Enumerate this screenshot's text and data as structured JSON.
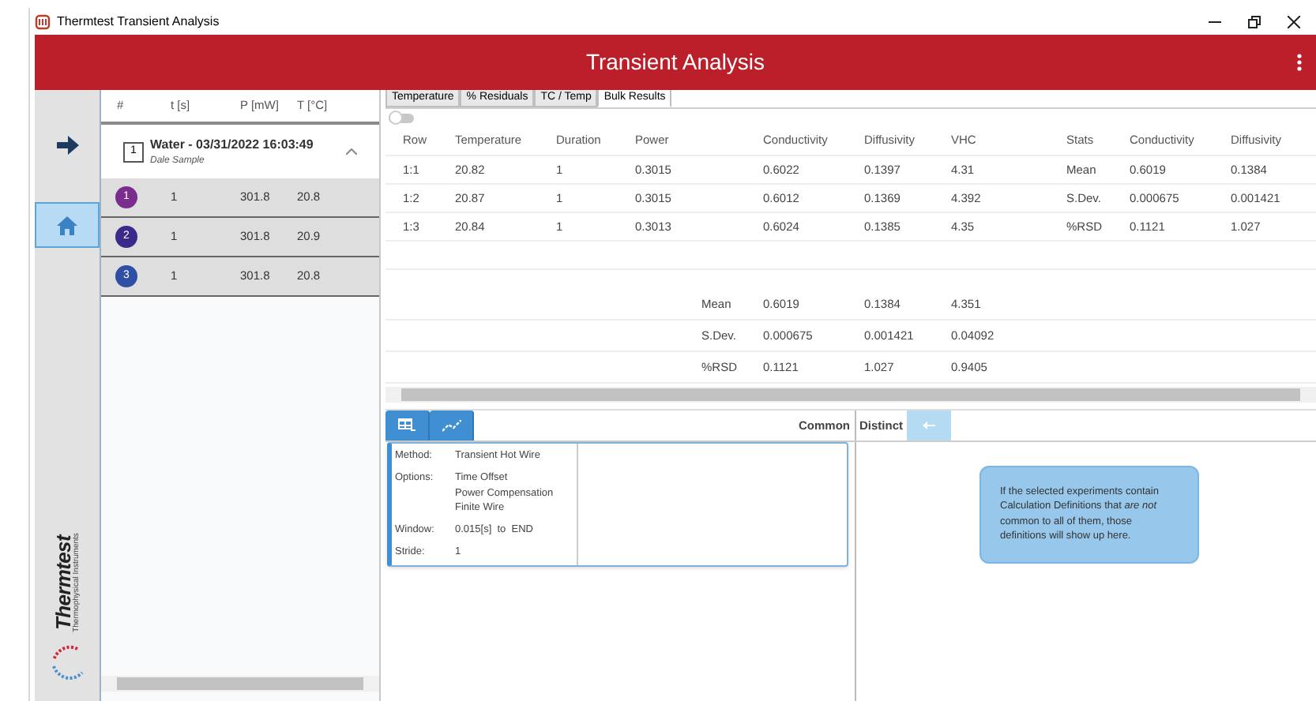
{
  "window": {
    "title": "Thermtest Transient Analysis"
  },
  "header": {
    "title": "Transient Analysis"
  },
  "nav": [
    {
      "kind": "arrow",
      "selected": false
    },
    {
      "kind": "home",
      "selected": true
    }
  ],
  "logo": {
    "name": "Thermtest",
    "tagline": "Thermophysical Instruments"
  },
  "list": {
    "columns": [
      "#",
      "t [s]",
      "P [mW]",
      "T [°C]"
    ],
    "group": {
      "number": "1",
      "title": "Water - 03/31/2022 16:03:49",
      "subtitle": "Dale Sample",
      "expanded": true
    },
    "rows": [
      {
        "index": "1",
        "color": "#7b2d8e",
        "t": "1",
        "p": "301.8",
        "temp": "20.8"
      },
      {
        "index": "2",
        "color": "#3b2a8c",
        "t": "1",
        "p": "301.8",
        "temp": "20.9"
      },
      {
        "index": "3",
        "color": "#2f4ea6",
        "t": "1",
        "p": "301.8",
        "temp": "20.8"
      }
    ]
  },
  "tabs": [
    {
      "label": "Temperature",
      "selected": false
    },
    {
      "label": "% Residuals",
      "selected": false
    },
    {
      "label": "TC / Temp",
      "selected": false
    },
    {
      "label": "Bulk Results",
      "selected": true
    }
  ],
  "pin_toggle": {
    "on": false
  },
  "results": {
    "columns": [
      "Row",
      "Temperature",
      "Duration",
      "Power",
      "Conductivity",
      "Diffusivity",
      "VHC",
      "Stats",
      "Conductivity",
      "Diffusivity"
    ],
    "rows": [
      [
        "1:1",
        "20.82",
        "1",
        "0.3015",
        "0.6022",
        "0.1397",
        "4.31",
        "Mean",
        "0.6019",
        "0.1384"
      ],
      [
        "1:2",
        "20.87",
        "1",
        "0.3015",
        "0.6012",
        "0.1369",
        "4.392",
        "S.Dev.",
        "0.000675",
        "0.001421"
      ],
      [
        "1:3",
        "20.84",
        "1",
        "0.3013",
        "0.6024",
        "0.1385",
        "4.35",
        "%RSD",
        "0.1121",
        "1.027"
      ]
    ],
    "summary": [
      {
        "label": "Mean",
        "values": [
          "0.6019",
          "0.1384",
          "4.351"
        ]
      },
      {
        "label": "S.Dev.",
        "values": [
          "0.000675",
          "0.001421",
          "0.04092"
        ]
      },
      {
        "label": "%RSD",
        "values": [
          "0.1121",
          "1.027",
          "0.9405"
        ]
      }
    ]
  },
  "definitions": {
    "tools": [
      {
        "kind": "table"
      },
      {
        "kind": "chart"
      }
    ],
    "common_label": "Common",
    "distinct_label": "Distinct",
    "fields": [
      {
        "label": "Method:",
        "values": [
          "Transient Hot Wire"
        ]
      },
      {
        "label": "Options:",
        "values": [
          "Time Offset",
          "Power Compensation",
          "Finite Wire"
        ]
      },
      {
        "label": "Window:",
        "values": [
          "0.015[s]  to  END"
        ]
      },
      {
        "label": "Stride:",
        "values": [
          "1"
        ]
      }
    ],
    "info": "If the selected experiments contain Calculation Definitions that *are not* common to all of them, those definitions will show up here."
  }
}
